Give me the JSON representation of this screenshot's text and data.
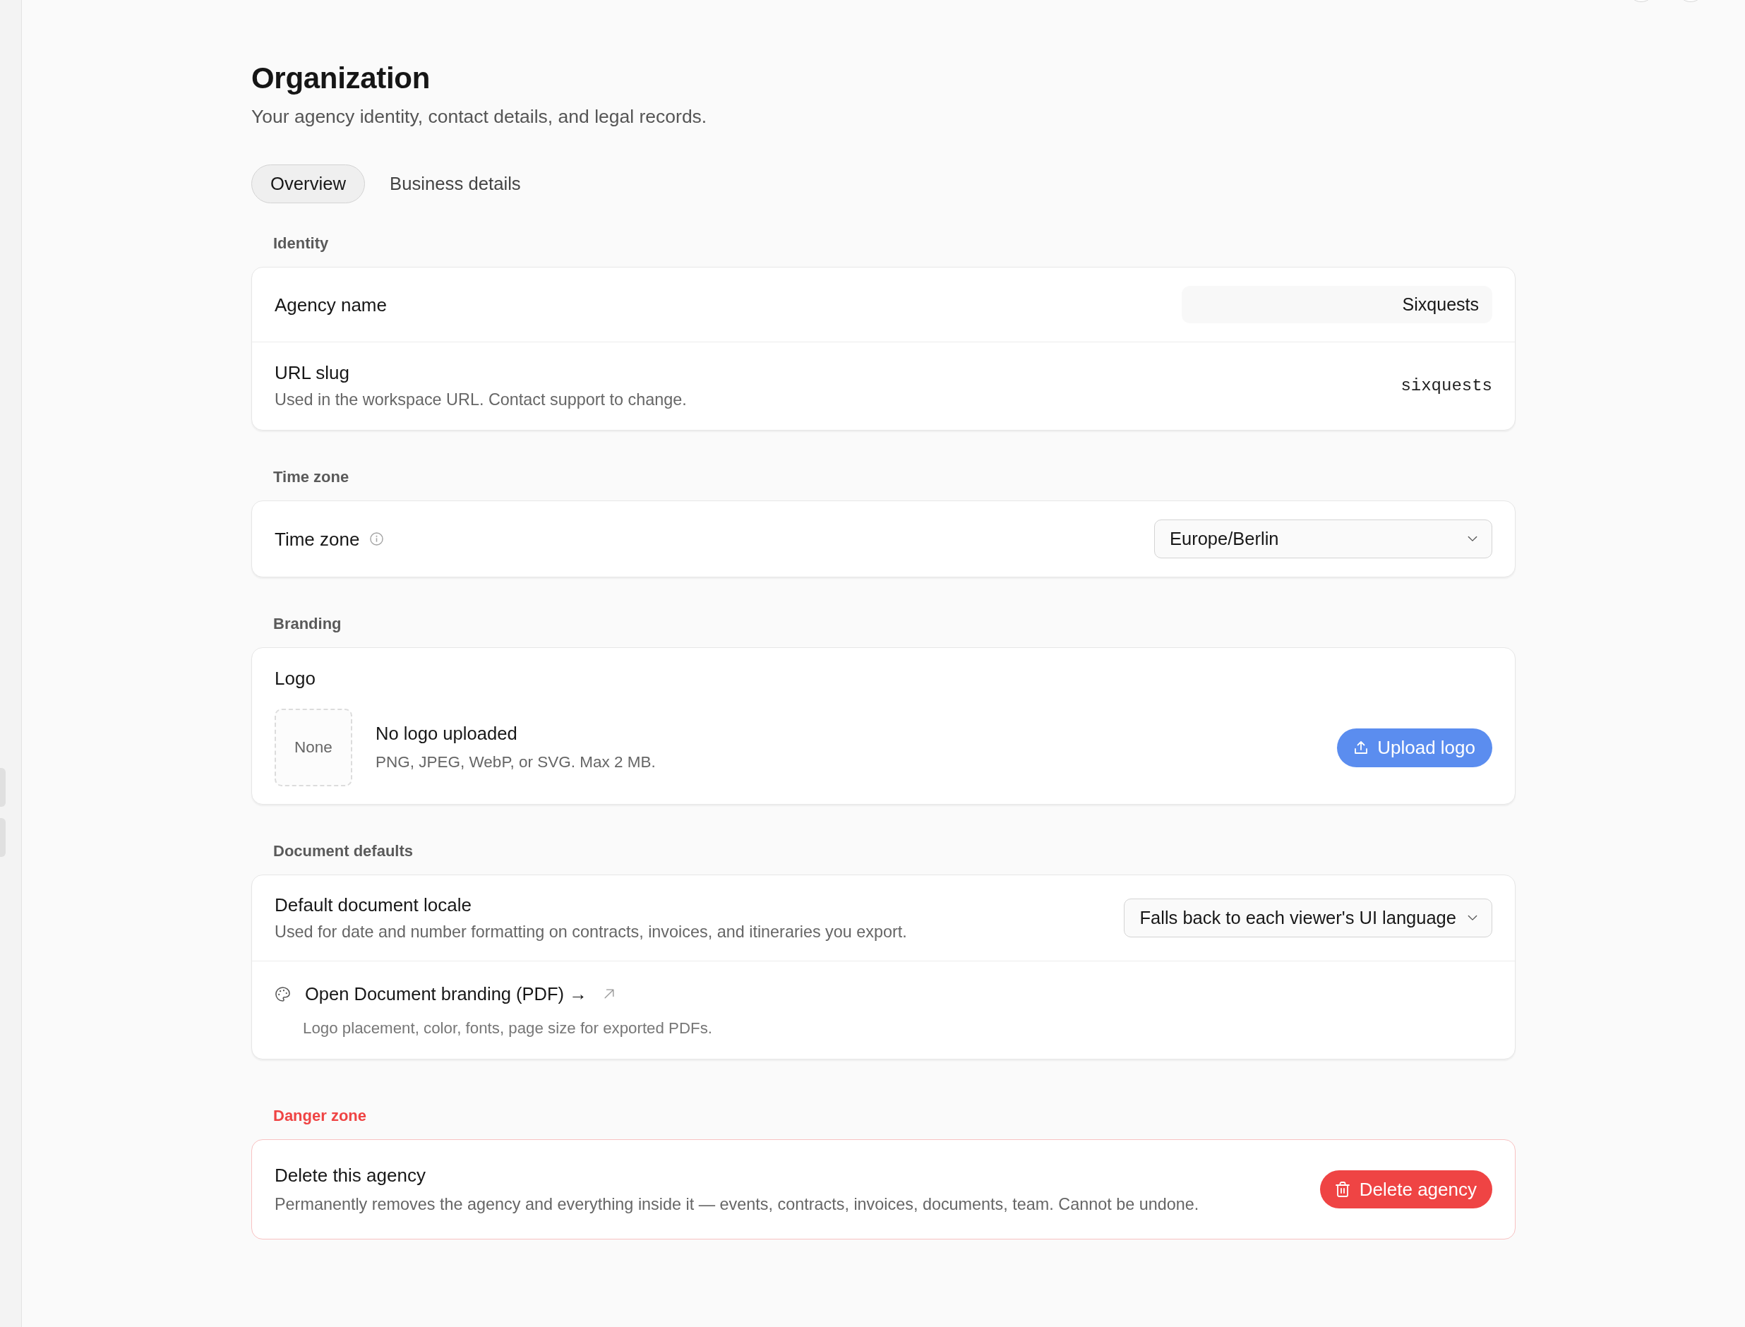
{
  "page": {
    "title": "Organization",
    "subtitle": "Your agency identity, contact details, and legal records."
  },
  "tabs": [
    {
      "label": "Overview",
      "selected": true
    },
    {
      "label": "Business details",
      "selected": false
    }
  ],
  "sections": [
    {
      "heading": "Identity",
      "rows": [
        {
          "kind": "text",
          "label": "Agency name",
          "value": "Sixquests"
        },
        {
          "kind": "code",
          "label": "URL slug",
          "description": "Used in the workspace URL. Contact support to change.",
          "value": "sixquests"
        }
      ]
    },
    {
      "heading": "Time zone",
      "rows": [
        {
          "kind": "select",
          "label": "Time zone",
          "info": true,
          "value": "Europe/Berlin"
        }
      ]
    },
    {
      "heading": "Branding",
      "rows": [
        {
          "kind": "logo",
          "label": "Logo",
          "preview": "None",
          "status": "No logo uploaded",
          "hint": "PNG, JPEG, WebP, or SVG. Max 2 MB.",
          "button": "Upload logo"
        }
      ]
    },
    {
      "heading": "Document defaults",
      "rows": [
        {
          "kind": "select",
          "label": "Default document locale",
          "description": "Used for date and number formatting on contracts, invoices, and itineraries you export.",
          "value": "Falls back to each viewer's UI language"
        },
        {
          "kind": "link",
          "label": "Open Document branding (PDF) →",
          "external": true,
          "description": "Logo placement, color, fonts, page size for exported PDFs."
        }
      ]
    },
    {
      "heading": "Danger zone",
      "danger": true,
      "rows": [
        {
          "kind": "action",
          "label": "Delete this agency",
          "description": "Permanently removes the agency and everything inside it — events, contracts, invoices, documents, team. Cannot be undone.",
          "button": "Delete agency"
        }
      ]
    }
  ]
}
